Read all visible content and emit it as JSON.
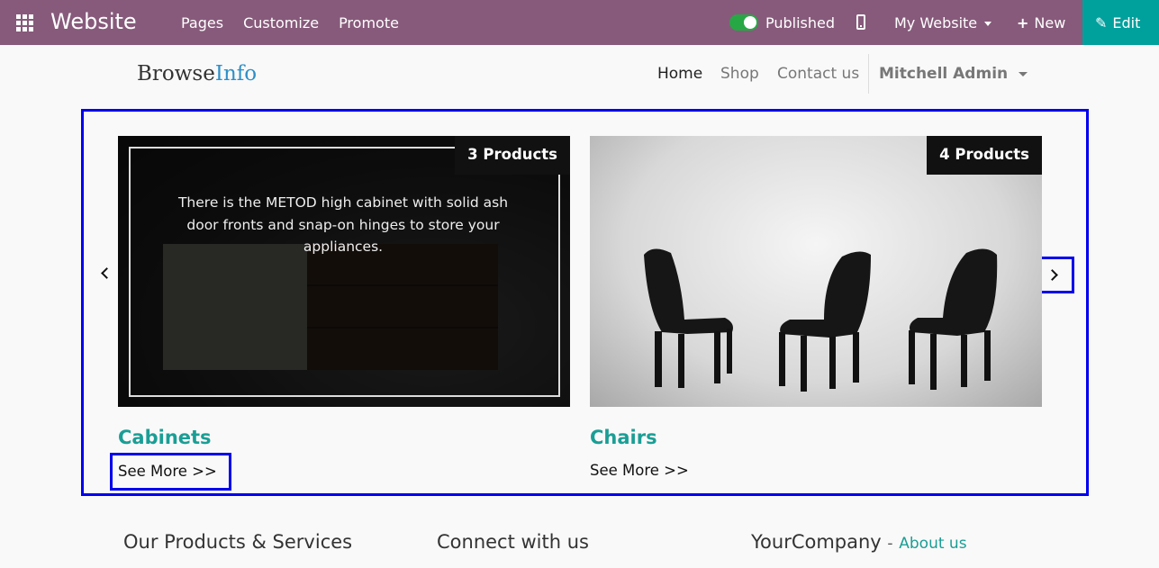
{
  "topbar": {
    "app_title": "Website",
    "menu": [
      "Pages",
      "Customize",
      "Promote"
    ],
    "published_label": "Published",
    "website_selector": "My Website",
    "new_label": "New",
    "edit_label": "Edit",
    "bar_color": "#875a7b",
    "edit_color": "#00a09d"
  },
  "site": {
    "logo_part1": "Browse",
    "logo_part2": "Info",
    "nav": {
      "home": "Home",
      "shop": "Shop",
      "contact": "Contact us",
      "user": "Mitchell Admin"
    }
  },
  "carousel": {
    "cards": [
      {
        "badge": "3 Products",
        "overlay_text": "There is the METOD high cabinet with solid ash door fronts and snap-on hinges to store your appliances.",
        "title": "Cabinets",
        "link": "See More >>"
      },
      {
        "badge": "4 Products",
        "title": "Chairs",
        "link": "See More >>"
      }
    ],
    "accent_color": "#1a9e95"
  },
  "footer": {
    "col1_title": "Our Products & Services",
    "col2_title": "Connect with us",
    "col3_title": "YourCompany",
    "col3_separator": "-",
    "col3_link": "About us"
  }
}
